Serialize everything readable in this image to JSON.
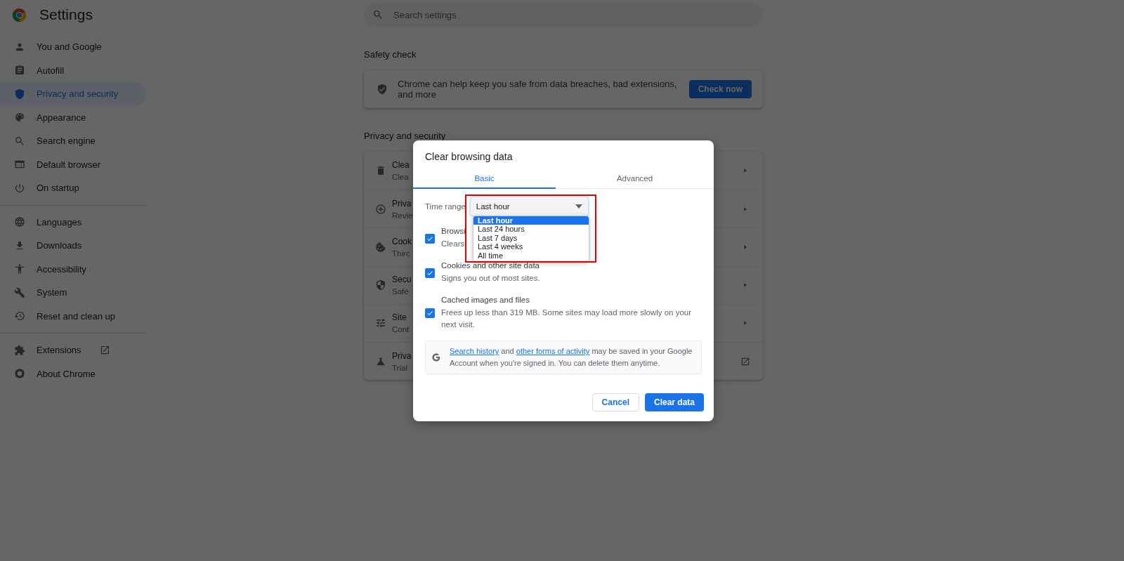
{
  "header": {
    "title": "Settings"
  },
  "search": {
    "placeholder": "Search settings"
  },
  "sidebar": {
    "groups": [
      {
        "items": [
          {
            "label": "You and Google",
            "selected": false
          },
          {
            "label": "Autofill",
            "selected": false
          },
          {
            "label": "Privacy and security",
            "selected": true
          },
          {
            "label": "Appearance",
            "selected": false
          },
          {
            "label": "Search engine",
            "selected": false
          },
          {
            "label": "Default browser",
            "selected": false
          },
          {
            "label": "On startup",
            "selected": false
          }
        ]
      },
      {
        "items": [
          {
            "label": "Languages",
            "selected": false
          },
          {
            "label": "Downloads",
            "selected": false
          },
          {
            "label": "Accessibility",
            "selected": false
          },
          {
            "label": "System",
            "selected": false
          },
          {
            "label": "Reset and clean up",
            "selected": false
          }
        ]
      },
      {
        "items": [
          {
            "label": "Extensions",
            "selected": false,
            "kind": "external"
          },
          {
            "label": "About Chrome",
            "selected": false
          }
        ]
      }
    ]
  },
  "safety_check": {
    "heading": "Safety check",
    "text": "Chrome can help keep you safe from data breaches, bad extensions, and more",
    "button": "Check now"
  },
  "privacy": {
    "heading": "Privacy and security",
    "rows": [
      {
        "title": "Clea",
        "subtitle": "Clea",
        "kind": "arrow"
      },
      {
        "title": "Priva",
        "subtitle": "Revie",
        "kind": "arrow"
      },
      {
        "title": "Cook",
        "subtitle": "Thirc",
        "kind": "arrow"
      },
      {
        "title": "Secu",
        "subtitle": "Safe",
        "kind": "arrow"
      },
      {
        "title": "Site",
        "subtitle": "Cont",
        "kind": "arrow"
      },
      {
        "title": "Priva",
        "subtitle": "Trial",
        "kind": "external"
      }
    ]
  },
  "dialog": {
    "title": "Clear browsing data",
    "tabs": [
      {
        "label": "Basic",
        "selected": true
      },
      {
        "label": "Advanced",
        "selected": false
      }
    ],
    "time_range": {
      "label": "Time range",
      "value": "Last hour",
      "expanded": true,
      "options": [
        {
          "label": "Last hour",
          "selected": true
        },
        {
          "label": "Last 24 hours",
          "selected": false
        },
        {
          "label": "Last 7 days",
          "selected": false
        },
        {
          "label": "Last 4 weeks",
          "selected": false
        },
        {
          "label": "All time",
          "selected": false
        }
      ]
    },
    "items": [
      {
        "title": "Browsi",
        "description": "Clears",
        "checked": true
      },
      {
        "title": "Cookies and other site data",
        "description": "Signs you out of most sites.",
        "checked": true
      },
      {
        "title": "Cached images and files",
        "description": "Frees up less than 319 MB. Some sites may load more slowly on your next visit.",
        "checked": true
      }
    ],
    "info": {
      "parts": [
        {
          "kind": "link",
          "text": "Search history"
        },
        {
          "kind": "text",
          "text": " and "
        },
        {
          "kind": "link",
          "text": "other forms of activity"
        },
        {
          "kind": "text",
          "text": " may be saved in your Google Account when you're signed in. You can delete them anytime."
        }
      ]
    },
    "buttons": [
      {
        "label": "Cancel",
        "kind": "secondary"
      },
      {
        "label": "Clear data",
        "kind": "primary"
      }
    ]
  },
  "highlight": {
    "shown": true
  }
}
